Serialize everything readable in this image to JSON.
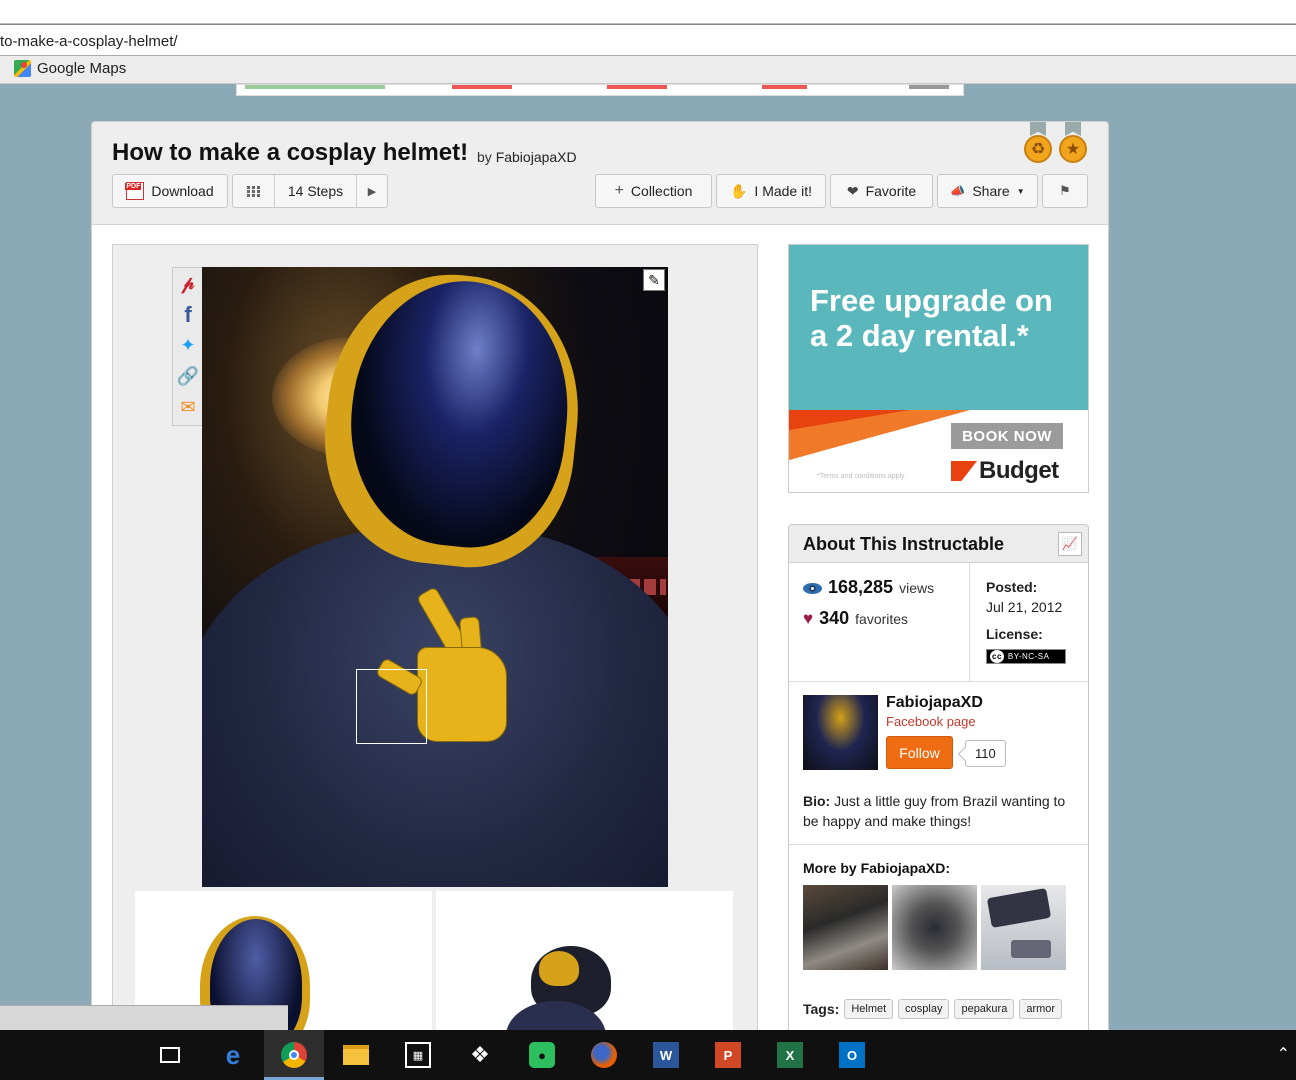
{
  "browser": {
    "url_fragment": "to-make-a-cosplay-helmet/",
    "bookmark_label": "Google Maps"
  },
  "header": {
    "title": "How to make a cosplay helmet!",
    "by": "by",
    "author": "FabiojapaXD"
  },
  "toolbar": {
    "download": "Download",
    "steps": "14 Steps",
    "collection": "Collection",
    "made_it": "I Made it!",
    "favorite": "Favorite",
    "share": "Share"
  },
  "ad": {
    "headline_line1": "Free upgrade on",
    "headline_line2": "a 2 day rental.*",
    "cta": "BOOK NOW",
    "terms": "*Terms and conditions apply",
    "brand": "Budget"
  },
  "about": {
    "title": "About This Instructable",
    "views_value": "168,285",
    "views_label": "views",
    "favorites_value": "340",
    "favorites_label": "favorites",
    "posted_label": "Posted:",
    "posted_date": "Jul 21, 2012",
    "license_label": "License:",
    "license_badge": "BY-NC-SA",
    "license_cc": "cc",
    "author_name": "FabiojapaXD",
    "facebook_link": "Facebook page",
    "follow_label": "Follow",
    "follower_count": "110",
    "bio_label": "Bio:",
    "bio_text": "Just a little guy from Brazil wanting to be happy and make things!",
    "more_by": "More by FabiojapaXD:",
    "tags_label": "Tags:",
    "tags": [
      "Helmet",
      "cosplay",
      "pepakura",
      "armor"
    ]
  },
  "colors": {
    "accent_orange": "#ef6c13",
    "page_bg": "#8ba9b6",
    "ad_teal": "#5ab8bc",
    "budget_orange": "#e8420f"
  },
  "icons": {
    "share_rail": [
      "pinterest-icon",
      "facebook-icon",
      "twitter-icon",
      "link-icon",
      "email-icon"
    ],
    "taskbar": [
      "task-view-icon",
      "edge-icon",
      "chrome-icon",
      "file-explorer-icon",
      "store-icon",
      "dropbox-icon",
      "evernote-icon",
      "firefox-icon",
      "word-icon",
      "powerpoint-icon",
      "excel-icon",
      "outlook-icon"
    ]
  }
}
